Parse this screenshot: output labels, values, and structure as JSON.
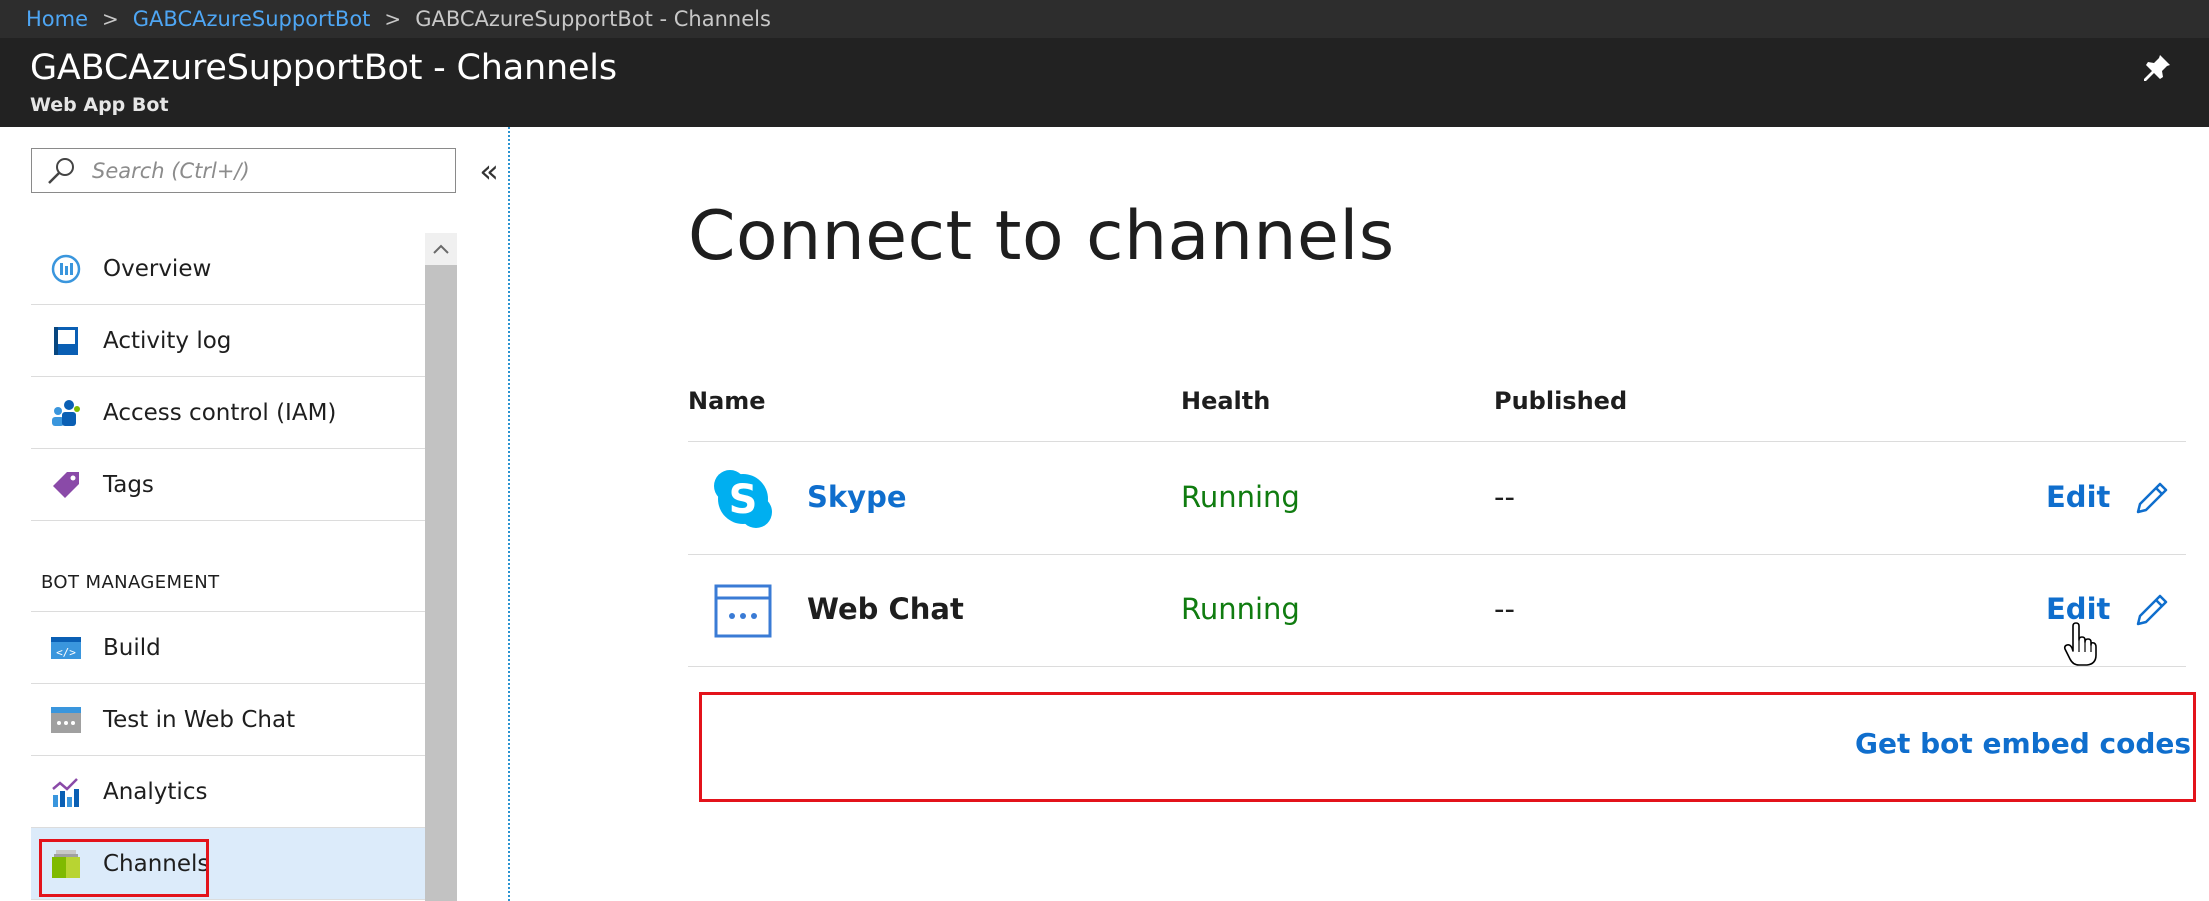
{
  "breadcrumb": {
    "home": "Home",
    "resource": "GABCAzureSupportBot",
    "current": "GABCAzureSupportBot - Channels"
  },
  "header": {
    "title": "GABCAzureSupportBot - Channels",
    "subtitle": "Web App Bot",
    "pin_icon": "pin-icon"
  },
  "sidebar": {
    "search_placeholder": "Search (Ctrl+/)",
    "collapse_label": "«",
    "items": [
      {
        "label": "Overview",
        "icon": "overview-icon"
      },
      {
        "label": "Activity log",
        "icon": "activity-log-icon"
      },
      {
        "label": "Access control (IAM)",
        "icon": "access-control-icon"
      },
      {
        "label": "Tags",
        "icon": "tag-icon"
      }
    ],
    "section_label": "BOT MANAGEMENT",
    "bot_items": [
      {
        "label": "Build",
        "icon": "build-icon"
      },
      {
        "label": "Test in Web Chat",
        "icon": "test-web-chat-icon"
      },
      {
        "label": "Analytics",
        "icon": "analytics-icon"
      },
      {
        "label": "Channels",
        "icon": "channels-icon",
        "selected": true
      }
    ]
  },
  "main": {
    "heading": "Connect to channels",
    "columns": [
      "Name",
      "Health",
      "Published"
    ],
    "channels": [
      {
        "name": "Skype",
        "health": "Running",
        "published": "--",
        "edit": "Edit",
        "icon": "skype-icon"
      },
      {
        "name": "Web Chat",
        "health": "Running",
        "published": "--",
        "edit": "Edit",
        "icon": "web-chat-icon"
      }
    ],
    "embed_link": "Get bot embed codes"
  },
  "colors": {
    "accent_link": "#0f6ecd",
    "running_green": "#107c10",
    "highlight_red": "#e3131b",
    "header_bg": "#222222",
    "selected_bg": "#dcebfa"
  }
}
